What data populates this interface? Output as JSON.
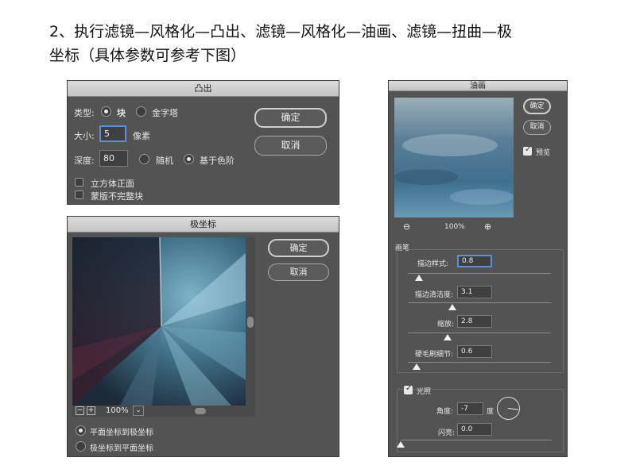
{
  "heading": {
    "line1": "2、执行滤镜—风格化—凸出、滤镜—风格化—油画、滤镜—扭曲—极",
    "line2": "坐标（具体参数可参考下图）"
  },
  "extrude": {
    "title": "凸出",
    "type_label": "类型:",
    "type_block": "块",
    "type_pyramid": "金字塔",
    "size_label": "大小:",
    "size_value": "5",
    "size_unit": "像素",
    "depth_label": "深度:",
    "depth_value": "80",
    "random_label": "随机",
    "level_label": "基于色阶",
    "solid_front": "立方体正面",
    "mask_incomplete": "蒙版不完整块",
    "ok": "确定",
    "cancel": "取消",
    "selected_type": "块",
    "selected_depth_mode": "基于色阶"
  },
  "polar": {
    "title": "极坐标",
    "ok": "确定",
    "cancel": "取消",
    "zoom": "100%",
    "zoom_minus": "−",
    "zoom_plus": "+",
    "dropdown": "⌄",
    "opt_rect_to_polar": "平面坐标到极坐标",
    "opt_polar_to_rect": "极坐标到平面坐标",
    "selected": "平面坐标到极坐标"
  },
  "oil": {
    "title": "油画",
    "ok": "确定",
    "cancel": "取消",
    "preview_label": "预览",
    "preview_checked": true,
    "zoom": "100%",
    "zoom_out_icon": "⊖",
    "zoom_in_icon": "⊕",
    "brush_group": "画笔",
    "stylization_label": "描边样式:",
    "stylization_value": "0.8",
    "stylization_level": 0.08,
    "cleanliness_label": "描边清洁度:",
    "cleanliness_value": "3.1",
    "cleanliness_level": 0.31,
    "scale_label": "缩放:",
    "scale_value": "2.8",
    "scale_level": 0.28,
    "bristle_label": "硬毛刷细节:",
    "bristle_value": "0.6",
    "bristle_level": 0.06,
    "lighting_label": "光照",
    "lighting_checked": true,
    "angle_label": "角度:",
    "angle_value": "-7",
    "angle_unit": "度",
    "shine_label": "闪亮:",
    "shine_value": "0.0",
    "shine_level": 0.0
  }
}
